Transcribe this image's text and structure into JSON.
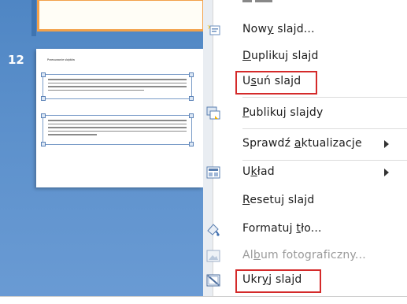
{
  "slide_panel": {
    "slide_number": "12",
    "thumbnail_title": "Przesuwanie slajdów",
    "placeholder_lines_1": 5,
    "placeholder_lines_2": 5
  },
  "menu": {
    "items": [
      {
        "label_pre": "Now",
        "label_ul": "y",
        "label_post": " slajd...",
        "icon": "new-slide-icon",
        "highlighted": false
      },
      {
        "label_pre": "",
        "label_ul": "D",
        "label_post": "uplikuj slajd",
        "icon": "",
        "highlighted": false
      },
      {
        "label_pre": "U",
        "label_ul": "s",
        "label_post": "uń slajd",
        "icon": "",
        "highlighted": true
      },
      {
        "label_pre": "",
        "label_ul": "P",
        "label_post": "ublikuj slajdy",
        "icon": "publish-slides-icon",
        "highlighted": false
      },
      {
        "label_pre": "Sprawdź ",
        "label_ul": "a",
        "label_post": "ktualizacje",
        "icon": "",
        "highlighted": false,
        "submenu": true
      },
      {
        "label_pre": "U",
        "label_ul": "k",
        "label_post": "ład",
        "icon": "layout-icon",
        "highlighted": false,
        "submenu": true
      },
      {
        "label_pre": "",
        "label_ul": "R",
        "label_post": "esetuj slajd",
        "icon": "",
        "highlighted": false
      },
      {
        "label_pre": "Formatuj ",
        "label_ul": "t",
        "label_post": "ło...",
        "icon": "format-background-icon",
        "highlighted": false
      },
      {
        "label_pre": "Al",
        "label_ul": "b",
        "label_post": "um fotograficzny...",
        "icon": "photo-album-icon",
        "highlighted": false,
        "disabled": true
      },
      {
        "label_pre": "Ukr",
        "label_ul": "y",
        "label_post": "j slajd",
        "icon": "hide-slide-icon",
        "highlighted": true
      }
    ]
  },
  "colors": {
    "panel_blue": "#5d91cc",
    "highlight_red": "#d42a2a",
    "selection_orange": "#f2a14b"
  }
}
